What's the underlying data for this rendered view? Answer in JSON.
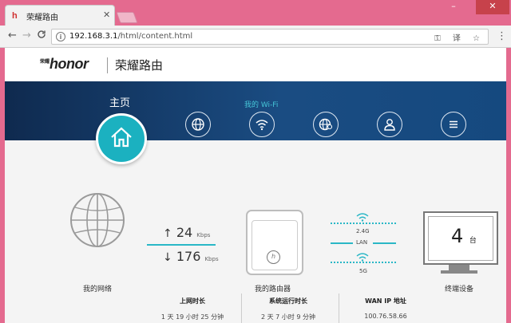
{
  "browser": {
    "tab_title": "荣耀路由",
    "favicon": "h",
    "close": "✕",
    "url_host": "192.168.3.1",
    "url_path": "/html/content.html",
    "back": "←",
    "forward": "→",
    "reload": "C",
    "menu": "⋮",
    "window_min": "–",
    "window_close": "✕",
    "omni_icons": "⚿ 译 ☆"
  },
  "header": {
    "logo_cn": "荣耀",
    "logo": "honor",
    "title": "荣耀路由"
  },
  "nav": {
    "home_label": "主页",
    "wifi_label": "我的 Wi-Fi"
  },
  "network": {
    "label": "我的网络",
    "upload_value": "24",
    "upload_unit": "Kbps",
    "download_value": "176",
    "download_unit": "Kbps"
  },
  "router": {
    "label": "我的路由器",
    "band_24": "2.4G",
    "lan": "LAN",
    "band_5": "5G",
    "logo": "h"
  },
  "devices": {
    "label": "终端设备",
    "count": "4",
    "unit": "台"
  },
  "stats": [
    {
      "title": "上网时长",
      "value": "1 天 19 小时 25 分钟"
    },
    {
      "title": "系统运行时长",
      "value": "2 天 7 小时 9 分钟"
    },
    {
      "title": "WAN IP 地址",
      "value": "100.76.58.66"
    }
  ],
  "colors": {
    "accent": "#1bb1c0",
    "nav_bg": "#15497f",
    "window_frame": "#e46a8f"
  }
}
